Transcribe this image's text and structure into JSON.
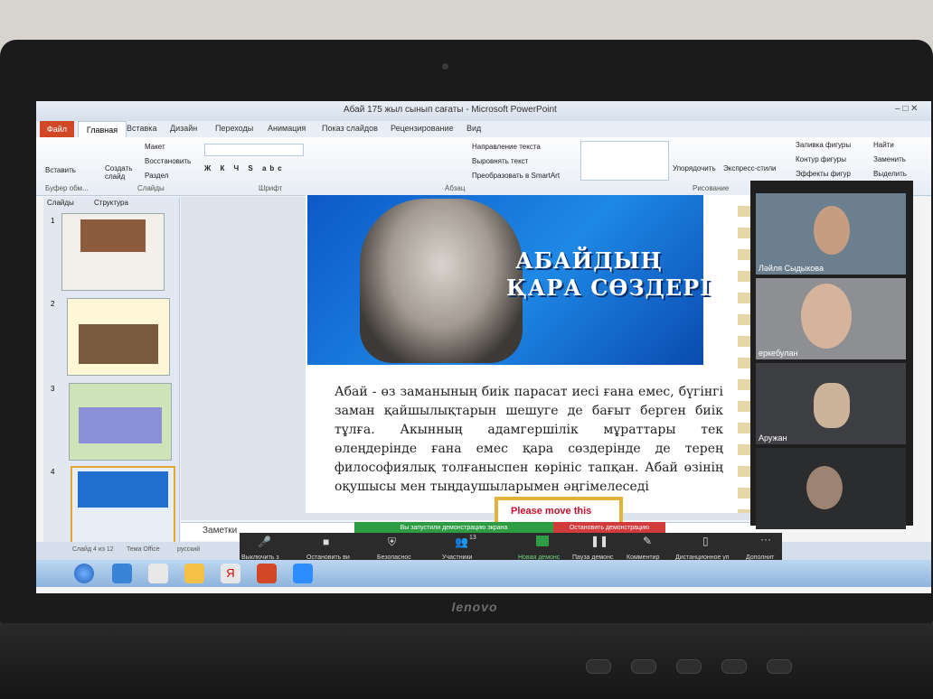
{
  "laptop": {
    "brand": "lenovo"
  },
  "window": {
    "title": "Абай 175 жыл сынып сағаты - Microsoft PowerPoint"
  },
  "ribbon": {
    "tabs": [
      "Файл",
      "Главная",
      "Вставка",
      "Дизайн",
      "Переходы",
      "Анимация",
      "Показ слайдов",
      "Рецензирование",
      "Вид"
    ],
    "items": {
      "paste": "Вставить",
      "create_slide": "Создать слайд",
      "layout": "Макет",
      "reset": "Восстановить",
      "section": "Раздел",
      "text_direction": "Направление текста",
      "align_text": "Выровнять текст",
      "smartart": "Преобразовать в SmartArt",
      "arrange": "Упорядочить",
      "quick_styles": "Экспресс-стили",
      "shape_fill": "Заливка фигуры",
      "shape_outline": "Контур фигуры",
      "shape_effects": "Эффекты фигур",
      "find": "Найти",
      "replace": "Заменить",
      "select": "Выделить"
    },
    "groups": {
      "clipboard": "Буфер обм...",
      "slides": "Слайды",
      "font": "Шрифт",
      "paragraph": "Абзац",
      "drawing": "Рисование"
    }
  },
  "leftpanel": {
    "tab_slides": "Слайды",
    "tab_outline": "Структура",
    "numbers": [
      "1",
      "2",
      "3",
      "4"
    ]
  },
  "slide": {
    "title_line1": "АБАЙДЫҢ",
    "title_line2": "ҚАРА СӨЗДЕРІ",
    "body": "Абай - өз заманының биік парасат иесі ғана емес, бүгінгі заман қайшылықтарын шешуге де бағыт берген биік тұлға. Акынның адамгершілік мұраттары тек өлеңдерінде ғана емес қара сөздерінде де терең философиялық толғаныспен көрініс тапқан. Абай өзінің оқушысы мен тыңдаушыларымен әңгімелеседі",
    "button": "Please move this"
  },
  "notes": {
    "label": "Заметки"
  },
  "status": {
    "slide": "Слайд 4 из 12",
    "theme": "Тема Office",
    "lang": "русский"
  },
  "zoom": {
    "share_notice": "Вы запустили демонстрацию экрана",
    "stop_share": "Остановить демонстрацию",
    "participants_count": "13",
    "toolbar": [
      "Выключить з",
      "Остановить ви",
      "Безопаснос",
      "Участники",
      "Новая демонс",
      "Пауза демонс",
      "Комментир",
      "Дистанционное уп",
      "Дополнит"
    ],
    "participants": [
      "Ләйля Сыдыкова",
      "еркебулан",
      "Аружан",
      ""
    ]
  }
}
